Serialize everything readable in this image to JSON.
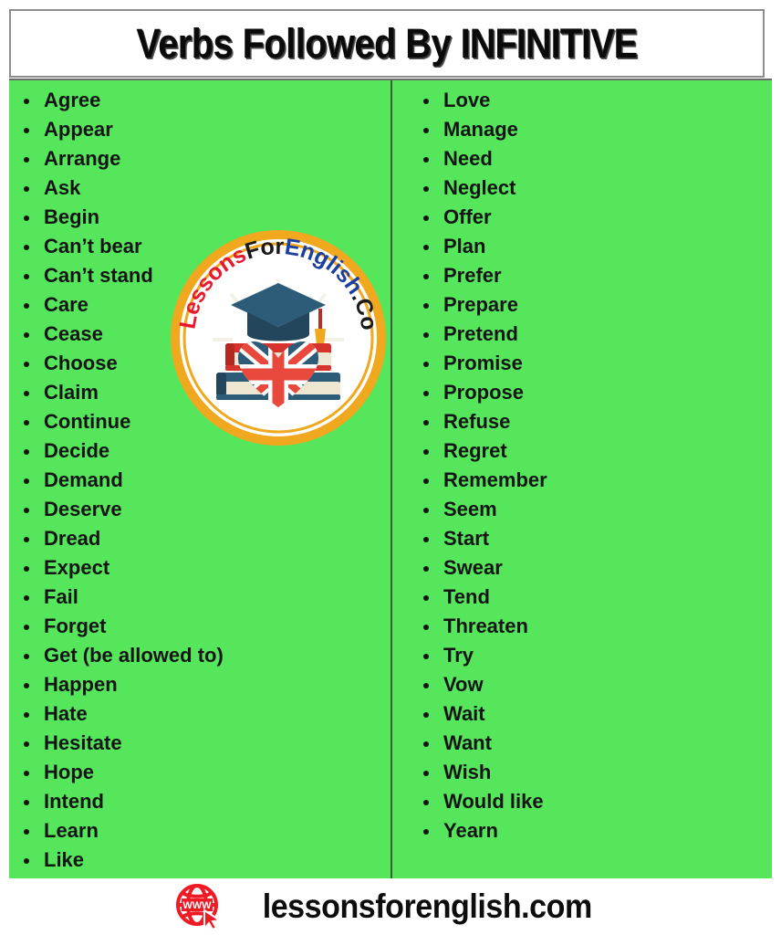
{
  "header": {
    "title_prefix": "Verbs Followed By ",
    "title_emphasis": "INFINITIVE",
    "title_full": "Verbs Followed By INFINITIVE"
  },
  "colors": {
    "panel_green": "#55E65C",
    "title_text": "#0A0A0A",
    "list_text": "#141414",
    "divider": "#3C5C3E",
    "border": "#8D8D8D",
    "logo_ring_gold": "#F0A81E",
    "logo_red": "#E8192C",
    "logo_blue": "#1B3FA0",
    "logo_dark": "#1A1A1A",
    "footer_globe_red": "#EE1B24"
  },
  "columns": {
    "left": [
      "Agree",
      "Appear",
      "Arrange",
      "Ask",
      "Begin",
      "Can’t bear",
      "Can’t stand",
      "Care",
      "Cease",
      "Choose",
      "Claim",
      "Continue",
      "Decide",
      "Demand",
      "Deserve",
      "Dread",
      "Expect",
      "Fail",
      "Forget",
      "Get (be allowed to)",
      "Happen",
      "Hate",
      "Hesitate",
      "Hope",
      "Intend",
      "Learn",
      "Like"
    ],
    "right": [
      "Love",
      "Manage",
      "Need",
      "Neglect",
      "Offer",
      "Plan",
      "Prefer",
      "Prepare",
      "Pretend",
      "Promise",
      "Propose",
      "Refuse",
      "Regret",
      "Remember",
      "Seem",
      "Start",
      "Swear",
      "Tend",
      "Threaten",
      "Try",
      "Vow",
      "Wait",
      "Want",
      "Wish",
      "Would like",
      "Yearn"
    ]
  },
  "logo": {
    "text_parts": [
      {
        "text": "Lessons",
        "color": "#E8192C"
      },
      {
        "text": "For",
        "color": "#1A1A1A"
      },
      {
        "text": "English",
        "color": "#1B3FA0"
      },
      {
        "text": ".Com",
        "color": "#1A1A1A"
      }
    ],
    "full_text": "LessonsForEnglish.Com",
    "emblem": "graduation-cap-books-uk-flag-heart"
  },
  "footer": {
    "icon": "www-globe-cursor-icon",
    "icon_label": "WWW",
    "website": "lessonsforenglish.com"
  }
}
